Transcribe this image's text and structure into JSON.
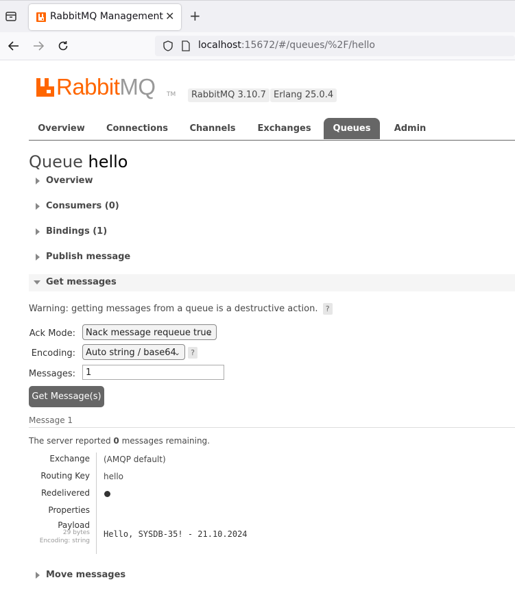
{
  "browser": {
    "tab_title": "RabbitMQ Management",
    "url_host": "localhost",
    "url_rest": ":15672/#/queues/%2F/hello"
  },
  "header": {
    "logo_rabbit": "Rabbit",
    "logo_mq": "MQ",
    "tm": "TM",
    "version": "RabbitMQ 3.10.7",
    "erlang": "Erlang 25.0.4"
  },
  "nav": [
    "Overview",
    "Connections",
    "Channels",
    "Exchanges",
    "Queues",
    "Admin"
  ],
  "page": {
    "title_prefix": "Queue",
    "title_name": "hello"
  },
  "sections": {
    "overview": "Overview",
    "consumers": "Consumers (0)",
    "bindings": "Bindings (1)",
    "publish": "Publish message",
    "get": "Get messages",
    "move": "Move messages"
  },
  "get_messages": {
    "warning": "Warning: getting messages from a queue is a destructive action.",
    "help": "?",
    "ack_mode_label": "Ack Mode:",
    "ack_mode_value": "Nack message requeue true",
    "encoding_label": "Encoding:",
    "encoding_value": "Auto string / base64",
    "messages_label": "Messages:",
    "messages_value": "1",
    "button": "Get Message(s)"
  },
  "result": {
    "header": "Message 1",
    "remaining_pre": "The server reported ",
    "remaining_count": "0",
    "remaining_post": " messages remaining.",
    "exchange_label": "Exchange",
    "exchange_value": "(AMQP default)",
    "routing_key_label": "Routing Key",
    "routing_key_value": "hello",
    "redelivered_label": "Redelivered",
    "properties_label": "Properties",
    "payload_label": "Payload",
    "payload_bytes": "29 bytes",
    "payload_encoding": "Encoding: string",
    "payload_value": "Hello, SYSDB-35! - 21.10.2024"
  },
  "colors": {
    "brand_orange": "#ff6600",
    "nav_selected": "#666666"
  }
}
